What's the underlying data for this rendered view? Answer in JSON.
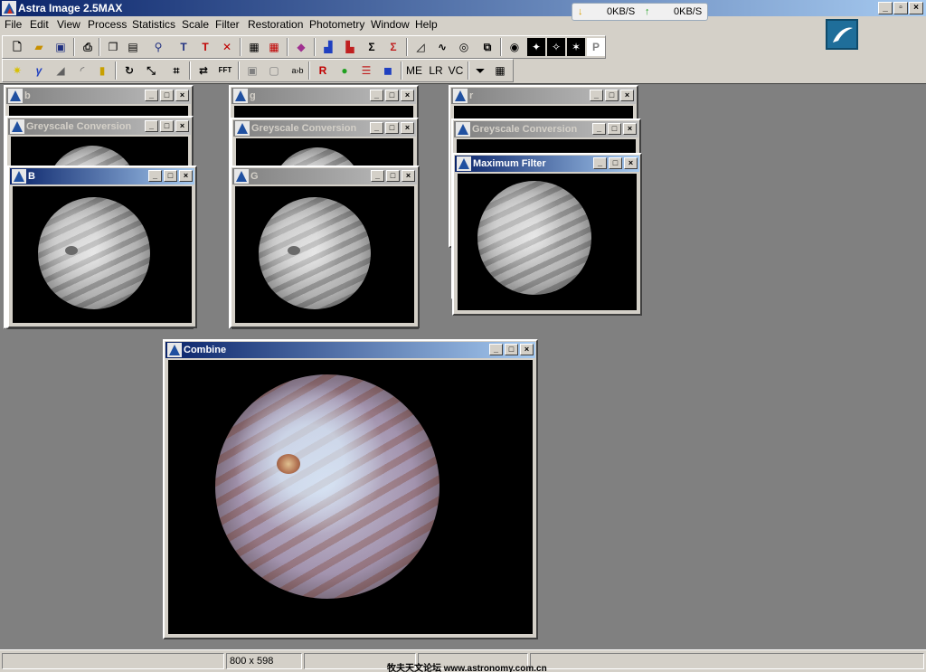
{
  "app": {
    "title": "Astra Image 2.5MAX"
  },
  "netmon": {
    "down": "0KB/S",
    "up": "0KB/S"
  },
  "menu": [
    "File",
    "Edit",
    "View",
    "Process",
    "Statistics",
    "Scale",
    "Filter",
    "Restoration",
    "Photometry",
    "Window",
    "Help"
  ],
  "toolbar2": {
    "me": "ME",
    "lr": "LR",
    "vc": "VC",
    "ab": "a›b"
  },
  "windows": {
    "b": "b",
    "b_grey": "Greyscale Conversion",
    "B": "B",
    "g": "g",
    "g_grey": "Greyscale Conversion",
    "G": "G",
    "r": "r",
    "r_grey": "Greyscale Conversion",
    "r_max": "Maximum Filter",
    "combine": "Combine"
  },
  "status": {
    "dims": "800 x 598",
    "watermark": "牧夫天文论坛 www.astronomy.com.cn"
  }
}
